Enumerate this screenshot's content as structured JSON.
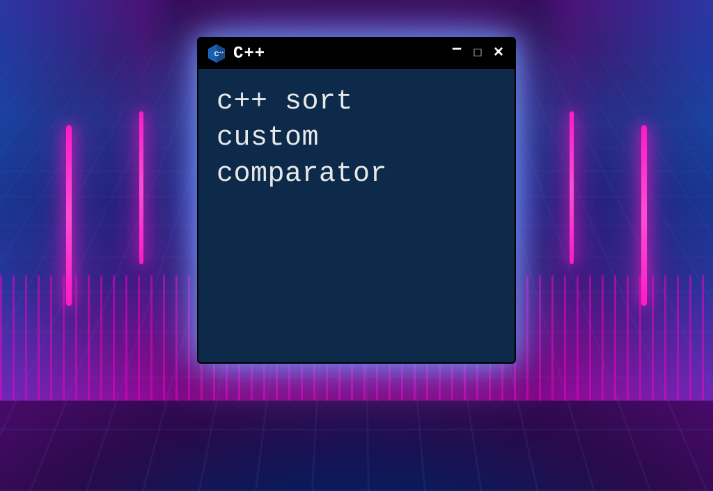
{
  "window": {
    "title": "C++",
    "icon_name": "cpp-logo-icon",
    "controls": {
      "minimize": "–",
      "maximize": "□",
      "close": "×"
    }
  },
  "body": {
    "line1": "c++ sort",
    "line2": "custom",
    "line3": "comparator"
  }
}
